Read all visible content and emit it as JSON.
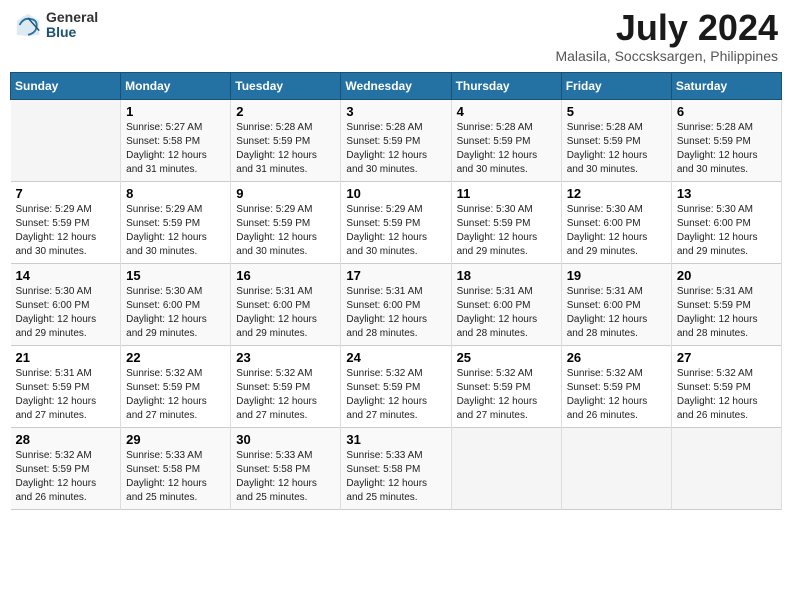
{
  "header": {
    "logo_general": "General",
    "logo_blue": "Blue",
    "month_year": "July 2024",
    "location": "Malasila, Soccsksargen, Philippines"
  },
  "weekdays": [
    "Sunday",
    "Monday",
    "Tuesday",
    "Wednesday",
    "Thursday",
    "Friday",
    "Saturday"
  ],
  "weeks": [
    [
      {
        "day": "",
        "info": ""
      },
      {
        "day": "1",
        "info": "Sunrise: 5:27 AM\nSunset: 5:58 PM\nDaylight: 12 hours\nand 31 minutes."
      },
      {
        "day": "2",
        "info": "Sunrise: 5:28 AM\nSunset: 5:59 PM\nDaylight: 12 hours\nand 31 minutes."
      },
      {
        "day": "3",
        "info": "Sunrise: 5:28 AM\nSunset: 5:59 PM\nDaylight: 12 hours\nand 30 minutes."
      },
      {
        "day": "4",
        "info": "Sunrise: 5:28 AM\nSunset: 5:59 PM\nDaylight: 12 hours\nand 30 minutes."
      },
      {
        "day": "5",
        "info": "Sunrise: 5:28 AM\nSunset: 5:59 PM\nDaylight: 12 hours\nand 30 minutes."
      },
      {
        "day": "6",
        "info": "Sunrise: 5:28 AM\nSunset: 5:59 PM\nDaylight: 12 hours\nand 30 minutes."
      }
    ],
    [
      {
        "day": "7",
        "info": "Sunrise: 5:29 AM\nSunset: 5:59 PM\nDaylight: 12 hours\nand 30 minutes."
      },
      {
        "day": "8",
        "info": "Sunrise: 5:29 AM\nSunset: 5:59 PM\nDaylight: 12 hours\nand 30 minutes."
      },
      {
        "day": "9",
        "info": "Sunrise: 5:29 AM\nSunset: 5:59 PM\nDaylight: 12 hours\nand 30 minutes."
      },
      {
        "day": "10",
        "info": "Sunrise: 5:29 AM\nSunset: 5:59 PM\nDaylight: 12 hours\nand 30 minutes."
      },
      {
        "day": "11",
        "info": "Sunrise: 5:30 AM\nSunset: 5:59 PM\nDaylight: 12 hours\nand 29 minutes."
      },
      {
        "day": "12",
        "info": "Sunrise: 5:30 AM\nSunset: 6:00 PM\nDaylight: 12 hours\nand 29 minutes."
      },
      {
        "day": "13",
        "info": "Sunrise: 5:30 AM\nSunset: 6:00 PM\nDaylight: 12 hours\nand 29 minutes."
      }
    ],
    [
      {
        "day": "14",
        "info": "Sunrise: 5:30 AM\nSunset: 6:00 PM\nDaylight: 12 hours\nand 29 minutes."
      },
      {
        "day": "15",
        "info": "Sunrise: 5:30 AM\nSunset: 6:00 PM\nDaylight: 12 hours\nand 29 minutes."
      },
      {
        "day": "16",
        "info": "Sunrise: 5:31 AM\nSunset: 6:00 PM\nDaylight: 12 hours\nand 29 minutes."
      },
      {
        "day": "17",
        "info": "Sunrise: 5:31 AM\nSunset: 6:00 PM\nDaylight: 12 hours\nand 28 minutes."
      },
      {
        "day": "18",
        "info": "Sunrise: 5:31 AM\nSunset: 6:00 PM\nDaylight: 12 hours\nand 28 minutes."
      },
      {
        "day": "19",
        "info": "Sunrise: 5:31 AM\nSunset: 6:00 PM\nDaylight: 12 hours\nand 28 minutes."
      },
      {
        "day": "20",
        "info": "Sunrise: 5:31 AM\nSunset: 5:59 PM\nDaylight: 12 hours\nand 28 minutes."
      }
    ],
    [
      {
        "day": "21",
        "info": "Sunrise: 5:31 AM\nSunset: 5:59 PM\nDaylight: 12 hours\nand 27 minutes."
      },
      {
        "day": "22",
        "info": "Sunrise: 5:32 AM\nSunset: 5:59 PM\nDaylight: 12 hours\nand 27 minutes."
      },
      {
        "day": "23",
        "info": "Sunrise: 5:32 AM\nSunset: 5:59 PM\nDaylight: 12 hours\nand 27 minutes."
      },
      {
        "day": "24",
        "info": "Sunrise: 5:32 AM\nSunset: 5:59 PM\nDaylight: 12 hours\nand 27 minutes."
      },
      {
        "day": "25",
        "info": "Sunrise: 5:32 AM\nSunset: 5:59 PM\nDaylight: 12 hours\nand 27 minutes."
      },
      {
        "day": "26",
        "info": "Sunrise: 5:32 AM\nSunset: 5:59 PM\nDaylight: 12 hours\nand 26 minutes."
      },
      {
        "day": "27",
        "info": "Sunrise: 5:32 AM\nSunset: 5:59 PM\nDaylight: 12 hours\nand 26 minutes."
      }
    ],
    [
      {
        "day": "28",
        "info": "Sunrise: 5:32 AM\nSunset: 5:59 PM\nDaylight: 12 hours\nand 26 minutes."
      },
      {
        "day": "29",
        "info": "Sunrise: 5:33 AM\nSunset: 5:58 PM\nDaylight: 12 hours\nand 25 minutes."
      },
      {
        "day": "30",
        "info": "Sunrise: 5:33 AM\nSunset: 5:58 PM\nDaylight: 12 hours\nand 25 minutes."
      },
      {
        "day": "31",
        "info": "Sunrise: 5:33 AM\nSunset: 5:58 PM\nDaylight: 12 hours\nand 25 minutes."
      },
      {
        "day": "",
        "info": ""
      },
      {
        "day": "",
        "info": ""
      },
      {
        "day": "",
        "info": ""
      }
    ]
  ]
}
